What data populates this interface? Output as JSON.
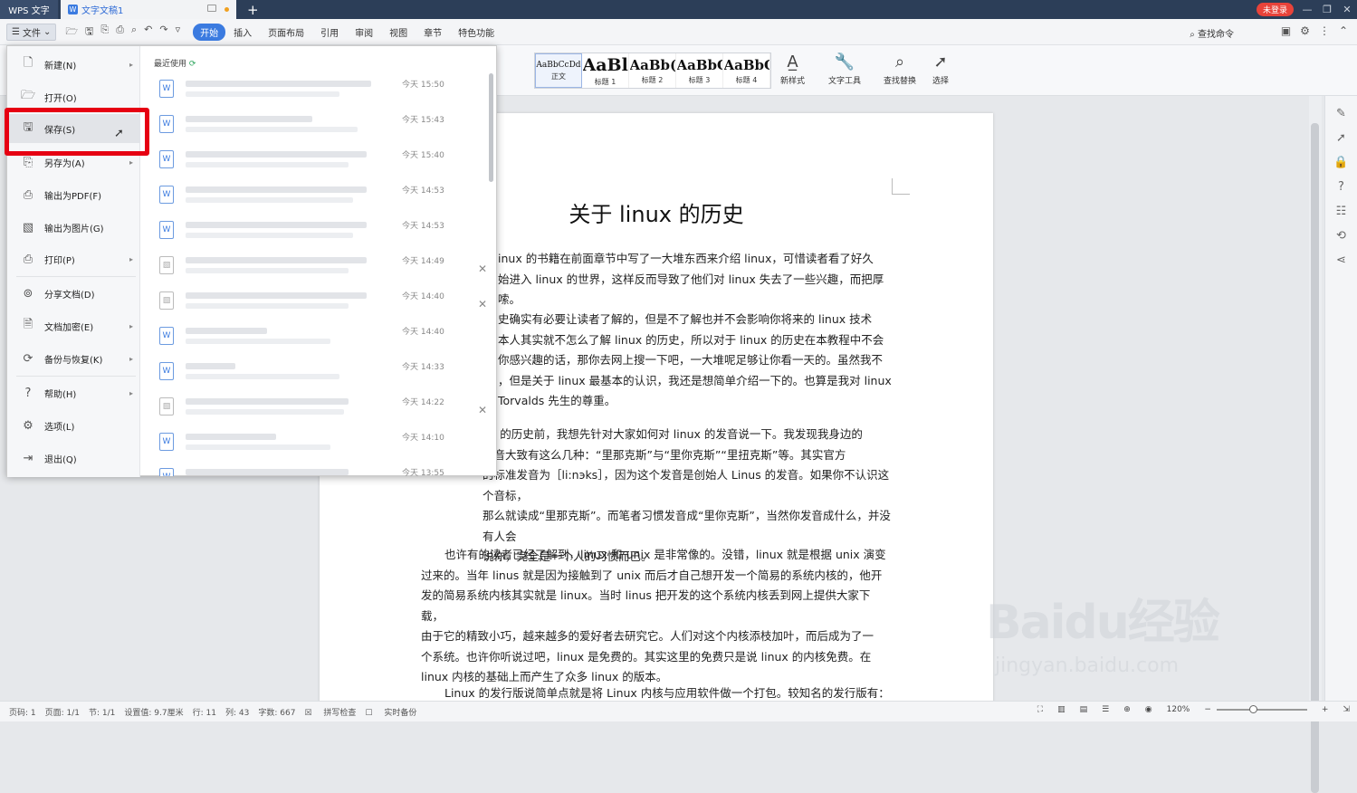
{
  "titlebar": {
    "app_tab": "WPS 文字",
    "doc_tab": "文字文稿1",
    "login": "未登录"
  },
  "menubar": {
    "file": "文件",
    "tabs": [
      "开始",
      "插入",
      "页面布局",
      "引用",
      "审阅",
      "视图",
      "章节",
      "特色功能"
    ],
    "search": "查找命令"
  },
  "ribbon": {
    "styles": [
      {
        "preview": "AaBbCcDd",
        "name": "正文"
      },
      {
        "preview": "AaBl",
        "name": "标题 1"
      },
      {
        "preview": "AaBb(",
        "name": "标题 2"
      },
      {
        "preview": "AaBbC",
        "name": "标题 3"
      },
      {
        "preview": "AaBbC",
        "name": "标题 4"
      }
    ],
    "new_style": "新样式",
    "text_tools": "文字工具",
    "find_replace": "查找替换",
    "select": "选择"
  },
  "file_menu": {
    "items": [
      {
        "label": "新建(N)",
        "icon": "new-doc-icon",
        "submenu": true
      },
      {
        "label": "打开(O)",
        "icon": "folder-icon",
        "submenu": false
      },
      {
        "label": "保存(S)",
        "icon": "save-icon",
        "submenu": false
      },
      {
        "label": "另存为(A)",
        "icon": "save-as-icon",
        "submenu": true
      },
      {
        "label": "输出为PDF(F)",
        "icon": "pdf-icon",
        "submenu": false
      },
      {
        "label": "输出为图片(G)",
        "icon": "image-export-icon",
        "submenu": false
      },
      {
        "label": "打印(P)",
        "icon": "print-icon",
        "submenu": true
      },
      {
        "label": "分享文档(D)",
        "icon": "share-icon",
        "submenu": false
      },
      {
        "label": "文档加密(E)",
        "icon": "encrypt-icon",
        "submenu": true
      },
      {
        "label": "备份与恢复(K)",
        "icon": "backup-icon",
        "submenu": true
      },
      {
        "label": "帮助(H)",
        "icon": "help-icon",
        "submenu": true
      },
      {
        "label": "选项(L)",
        "icon": "gear-icon",
        "submenu": false
      },
      {
        "label": "退出(Q)",
        "icon": "exit-icon",
        "submenu": false
      }
    ],
    "recent_title": "最近使用",
    "recent": [
      {
        "time": "今天 15:50"
      },
      {
        "time": "今天 15:43"
      },
      {
        "time": "今天 15:40"
      },
      {
        "time": "今天 14:53"
      },
      {
        "time": "今天 14:53"
      },
      {
        "time": "今天 14:49"
      },
      {
        "time": "今天 14:40"
      },
      {
        "time": "今天 14:40"
      },
      {
        "time": "今天 14:33"
      },
      {
        "time": "今天 14:22"
      },
      {
        "time": "今天 14:10"
      },
      {
        "time": "今天 13:55"
      }
    ]
  },
  "document": {
    "title": "关于 linux 的历史",
    "paragraphs": [
      "inux 的书籍在前面章节中写了一大堆东西来介绍 linux，可惜读者看了好久\n始进入 linux 的世界，这样反而导致了他们对 linux 失去了一些兴趣，而把厚\n嗦。",
      "史确实有必要让读者了解的，但是不了解也并不会影响你将来的 linux 技术\n本人其实就不怎么了解 linux 的历史，所以对于 linux 的历史在本教程中不会\n你感兴趣的话，那你去网上搜一下吧，一大堆呢足够让你看一天的。虽然我不\n，但是关于 linux 最基本的认识，我还是想简单介绍一下的。也算是我对 linux\n Torvalds 先生的尊重。",
      "ux 的历史前，我想先针对大家如何对 linux 的发音说一下。我发现我身边的\n发音大致有这么几种：“里那克斯”与“里你克斯”“里扭克斯”等。其实官方\n的标准发音为［li:nэks］，因为这个发音是创始人 Linus 的发音。如果你不认识这个音标，\n那么就读成“里那克斯”。而笔者习惯发音成“里你克斯”，当然你发音成什么，并没有人会\n说你，完全是一个人的习惯而已。",
      "也许有的读者已经了解到，linux 和 unix 是非常像的。没错，linux 就是根据 unix 演变\n过来的。当年 linus 就是因为接触到了 unix 而后才自己想开发一个简易的系统内核的，他开\n发的简易系统内核其实就是 linux。当时 linus 把开发的这个系统内核丢到网上提供大家下载，\n由于它的精致小巧，越来越多的爱好者去研究它。人们对这个内核添枝加叶，而后成为了一\n个系统。也许你听说过吧，linux 是免费的。其实这里的免费只是说 linux 的内核免费。在\nlinux 内核的基础上而产生了众多 linux 的版本。",
      "Linux 的发行版说简单点就是将 Linux 内核与应用软件做一个打包。较知名的发行版有："
    ]
  },
  "statusbar": {
    "page": "页码: 1",
    "pages": "页面: 1/1",
    "section": "节: 1/1",
    "setting": "设置值: 9.7厘米",
    "row": "行: 11",
    "col": "列: 43",
    "words": "字数: 667",
    "spell": "拼写检查",
    "backup": "实时备份",
    "zoom": "120%"
  },
  "watermark": {
    "brand": "Baidu经验",
    "url": "jingyan.baidu.com"
  }
}
